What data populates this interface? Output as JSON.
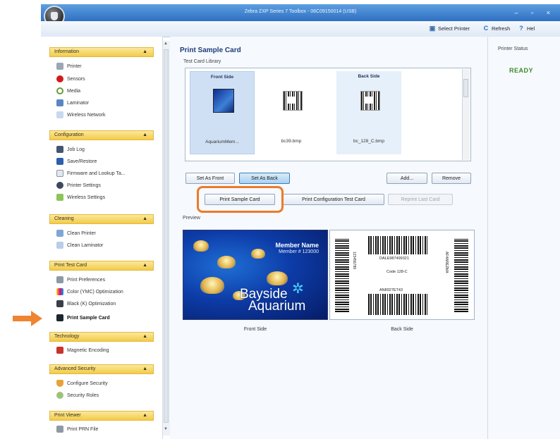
{
  "window": {
    "title": "Zebra ZXP Series 7 Toolbox - 06C09150014 (USB)",
    "controls": "– ▫ ×"
  },
  "toolbar": {
    "select_printer": "Select Printer",
    "refresh": "Refresh",
    "help": "Hel"
  },
  "sidebar": {
    "groups": [
      {
        "label": "Information",
        "items": [
          "Printer",
          "Sensors",
          "Media",
          "Laminator",
          "Wireless Network"
        ]
      },
      {
        "label": "Configuration",
        "items": [
          "Job Log",
          "Save/Restore",
          "Firmware and Lookup Ta...",
          "Printer Settings",
          "Wireless Settings"
        ]
      },
      {
        "label": "Cleaning",
        "items": [
          "Clean Printer",
          "Clean Laminator"
        ]
      },
      {
        "label": "Print Test Card",
        "items": [
          "Print Preferences",
          "Color (YMC) Optimization",
          "Black (K) Optimization",
          "Print Sample Card"
        ]
      },
      {
        "label": "Technology",
        "items": [
          "Magnetic Encoding"
        ]
      },
      {
        "label": "Advanced Security",
        "items": [
          "Configure Security",
          "Security Roles"
        ]
      },
      {
        "label": "Print Viewer",
        "items": [
          "Print PRN File"
        ]
      }
    ],
    "chevron": "▲"
  },
  "main": {
    "title": "Print Sample Card",
    "library_label": "Test Card Library",
    "library": [
      {
        "header": "Front Side",
        "name": "AquariumMem..."
      },
      {
        "header": "",
        "name": "bc39.bmp"
      },
      {
        "header": "Back Side",
        "name": "bc_128_C.bmp"
      }
    ],
    "buttons": {
      "set_front": "Set As Front",
      "set_back": "Set As Back",
      "add": "Add...",
      "remove": "Remove",
      "print_sample": "Print Sample Card",
      "print_config": "Print Configuration Test Card",
      "reprint_last": "Reprint Last Card"
    },
    "preview_label": "Preview",
    "front_card": {
      "member_name": "Member Name",
      "member_number": "Member # 123000",
      "brand_line1": "Bayside",
      "brand_line2": "Aquarium"
    },
    "back_card": {
      "code_top": "DALE987499321",
      "code_mid": "Code 128-C",
      "code_bottom": "AN8927ET43",
      "side_left": "123456789",
      "side_right": "AF4W9EZMA"
    },
    "front_caption": "Front Side",
    "back_caption": "Back Side"
  },
  "status": {
    "label": "Printer Status",
    "value": "READY"
  },
  "colors": {
    "accent": "#ee7a28",
    "ready": "#3d8a2a",
    "group_header": "#f3cb4a"
  }
}
